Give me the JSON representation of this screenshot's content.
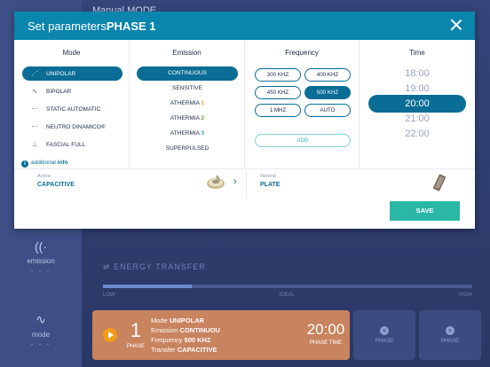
{
  "background": {
    "header_title": "Manual MODE",
    "sidebar": [
      {
        "label": "emission",
        "value": "- - -",
        "icon": "emission-waves-icon"
      },
      {
        "label": "mode",
        "value": "- - -",
        "icon": "mode-wave-icon"
      }
    ],
    "energy": {
      "title": "ENERGY TRANSFER",
      "level": 0.24,
      "scale": [
        "LOW",
        "IDEAL",
        "HIGH"
      ]
    },
    "phase": {
      "number": "1",
      "label": "PHASE",
      "mode_label": "Mode",
      "mode_value": "UNIPOLAR",
      "emission_label": "Emission",
      "emission_value": "CONTINUOU",
      "frequency_label": "Frequency",
      "frequency_value": "500 KHZ",
      "transfer_label": "Transfer",
      "transfer_value": "CAPACITIVE",
      "time": "20:00",
      "time_label": "PHASE TIME"
    },
    "phase_slots": [
      "PHASE",
      "PHASE"
    ]
  },
  "modal": {
    "title_prefix": "Set parameters",
    "title_phase": "PHASE 1",
    "columns": {
      "mode": "Mode",
      "emission": "Emission",
      "frequency": "Frequency",
      "time": "Time"
    },
    "modes": [
      {
        "label": "UNIPOLAR",
        "icon": "unipolar-icon",
        "glyph": "⋰",
        "selected": true
      },
      {
        "label": "BIPOLAR",
        "icon": "bipolar-icon",
        "glyph": "∿",
        "selected": false
      },
      {
        "label": "STATIC AUTOMATIC",
        "icon": "static-automatic-icon",
        "glyph": "⋯",
        "selected": false
      },
      {
        "label": "NEUTRO DINAMICO®",
        "icon": "neutro-dinamico-icon",
        "glyph": "⋯",
        "selected": false
      },
      {
        "label": "FASCIAL FULL",
        "icon": "fascial-full-icon",
        "glyph": "⊥",
        "selected": false
      }
    ],
    "emissions": [
      {
        "label": "CONTINUOUS",
        "selected": true
      },
      {
        "label": "SENSITIVE",
        "selected": false
      },
      {
        "label": "ATHERMIA",
        "num": "1",
        "selected": false
      },
      {
        "label": "ATHERMIA",
        "num": "2",
        "selected": false
      },
      {
        "label": "ATHERMIA",
        "num": "3",
        "selected": false
      },
      {
        "label": "SUPERPULSED",
        "selected": false
      }
    ],
    "frequencies": [
      {
        "label": "300 KHZ",
        "selected": false
      },
      {
        "label": "400 KHZ",
        "selected": false
      },
      {
        "label": "450 KHZ",
        "selected": false
      },
      {
        "label": "500 KHZ",
        "selected": true
      },
      {
        "label": "1 MHZ",
        "selected": false
      },
      {
        "label": "AUTO",
        "selected": false
      }
    ],
    "add_label": "ADD",
    "times": [
      {
        "label": "18:00",
        "selected": false
      },
      {
        "label": "19:00",
        "selected": false
      },
      {
        "label": "20:00",
        "selected": true
      },
      {
        "label": "21:00",
        "selected": false
      },
      {
        "label": "22:00",
        "selected": false
      }
    ],
    "info_prefix": "additional",
    "info_bold": "info",
    "active_label": "Active:",
    "active_value": "CAPACITIVE",
    "neutral_label": "Neutral",
    "neutral_value": "PLATE",
    "save_label": "SAVE"
  },
  "colors": {
    "primary": "#0a6d95",
    "header": "#0a85ad",
    "save": "#2bb7a6",
    "phase_bar": "#c8835f"
  }
}
